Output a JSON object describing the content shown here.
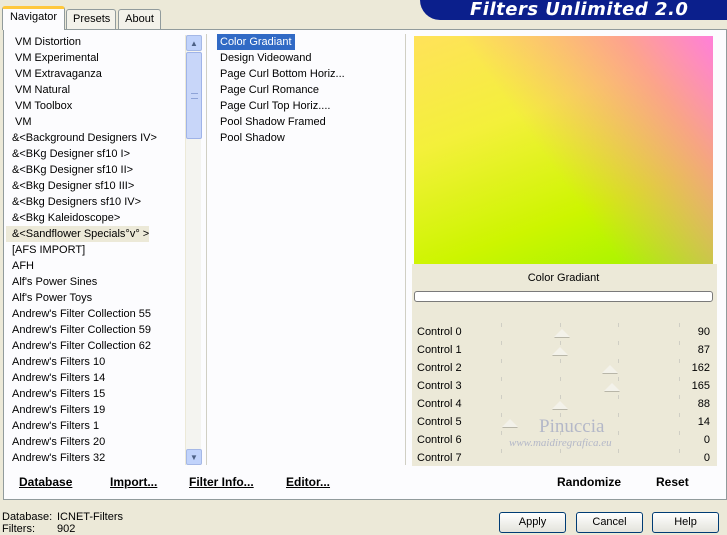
{
  "tabs": [
    "Navigator",
    "Presets",
    "About"
  ],
  "title": "Filters Unlimited 2.0",
  "categories": [
    "VM Distortion",
    "VM Experimental",
    "VM Extravaganza",
    "VM Natural",
    "VM Toolbox",
    "VM",
    "&<Background Designers IV>",
    "&<BKg Designer sf10 I>",
    "&<BKg Designer sf10 II>",
    "&<Bkg Designer sf10 III>",
    "&<Bkg Designers sf10 IV>",
    "&<Bkg Kaleidoscope>",
    "&<Sandflower Specials°v° >",
    "[AFS IMPORT]",
    "AFH",
    "Alf's Power Sines",
    "Alf's Power Toys",
    "Andrew's Filter Collection 55",
    "Andrew's Filter Collection 59",
    "Andrew's Filter Collection 62",
    "Andrew's Filters 10",
    "Andrew's Filters 14",
    "Andrew's Filters 15",
    "Andrew's Filters 19",
    "Andrew's Filters 1",
    "Andrew's Filters 20",
    "Andrew's Filters 32"
  ],
  "selected_category": "&<Sandflower Specials°v° >",
  "filters": [
    "Color Gradiant",
    "Design Videowand",
    "Page Curl Bottom Horiz...",
    "Page Curl Romance",
    "Page Curl Top Horiz....",
    "Pool Shadow Framed",
    "Pool Shadow"
  ],
  "selected_filter": "Color Gradiant",
  "filter_name": "Color Gradiant",
  "controls": [
    {
      "label": "Control 0",
      "value": "90",
      "level": 90
    },
    {
      "label": "Control 1",
      "value": "87",
      "level": 87
    },
    {
      "label": "Control 2",
      "value": "162",
      "level": 162
    },
    {
      "label": "Control 3",
      "value": "165",
      "level": 165
    },
    {
      "label": "Control 4",
      "value": "88",
      "level": 88
    },
    {
      "label": "Control 5",
      "value": "14",
      "level": 14
    },
    {
      "label": "Control 6",
      "value": "0",
      "level": 0
    },
    {
      "label": "Control 7",
      "value": "0",
      "level": 0
    }
  ],
  "watermark": {
    "name": "Pinuccia",
    "url": "www.maidiregrafica.eu"
  },
  "toolbar": {
    "database": "Database",
    "import": "Import...",
    "filter_info": "Filter Info...",
    "editor": "Editor...",
    "randomize": "Randomize",
    "reset": "Reset"
  },
  "status": {
    "database_label": "Database:",
    "database_value": "ICNET-Filters",
    "filters_label": "Filters:",
    "filters_value": "902"
  },
  "buttons": {
    "apply": "Apply",
    "cancel": "Cancel",
    "help": "Help"
  },
  "colors": {
    "selection": "#316ac5",
    "banner": "#0b1f8c"
  }
}
